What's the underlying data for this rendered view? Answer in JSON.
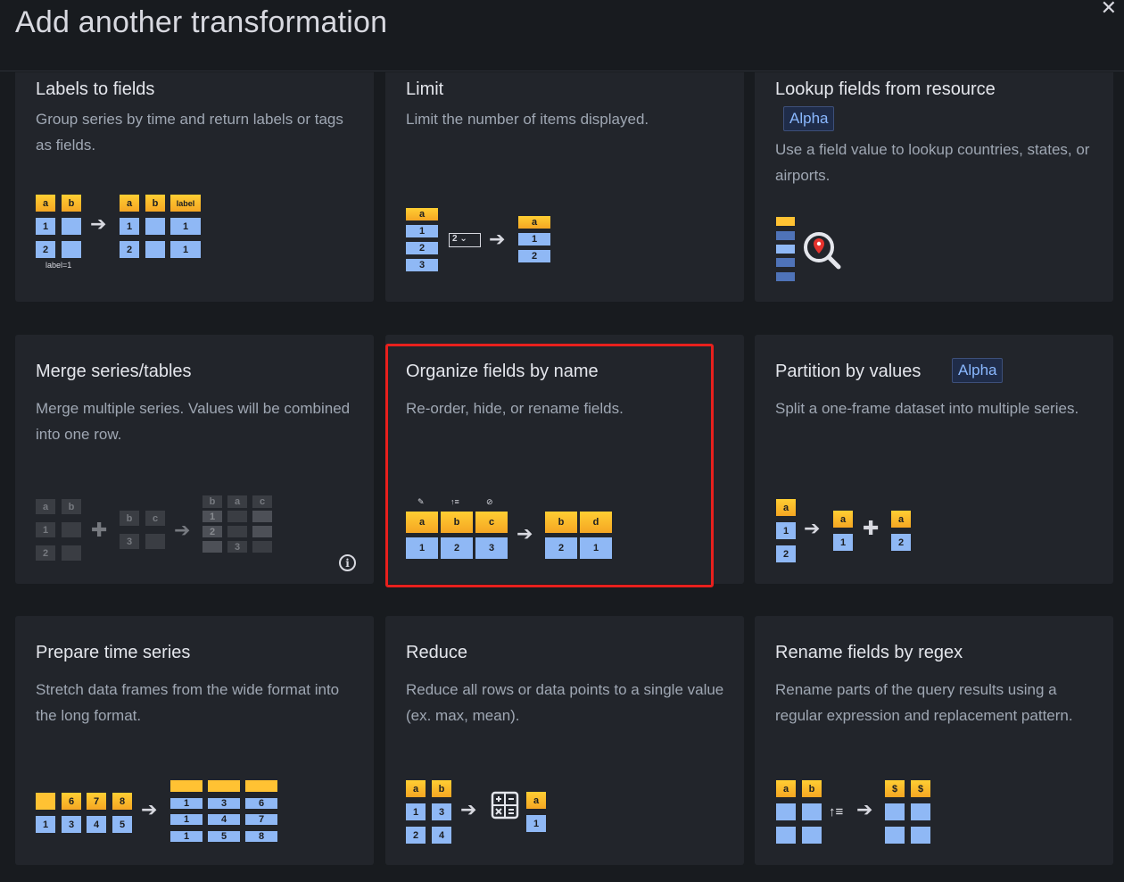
{
  "header": {
    "title": "Add another transformation",
    "close_icon": "close-icon"
  },
  "cards": [
    {
      "title": "Labels to fields",
      "description": "Group series by time and return labels or tags as fields."
    },
    {
      "title": "Limit",
      "description": "Limit the number of items displayed."
    },
    {
      "title": "Lookup fields from resource",
      "badge": "Alpha",
      "description": "Use a field value to lookup countries, states, or airports."
    },
    {
      "title": "Merge series/tables",
      "description": "Merge multiple series. Values will be combined into one row."
    },
    {
      "title": "Organize fields by name",
      "description": "Re-order, hide, or rename fields."
    },
    {
      "title": "Partition by values",
      "badge": "Alpha",
      "description": "Split a one-frame dataset into multiple series."
    },
    {
      "title": "Prepare time series",
      "description": "Stretch data frames from the wide format into the long format."
    },
    {
      "title": "Reduce",
      "description": "Reduce all rows or data points to a single value (ex. max, mean)."
    },
    {
      "title": "Rename fields by regex",
      "description": "Rename parts of the query results using a regular expression and replacement pattern."
    }
  ],
  "illustrations": {
    "labels_to_fields": {
      "h1": "a",
      "h2": "b",
      "label": "label",
      "r1": "1",
      "r2": "2",
      "out": "1",
      "caption": "label=1"
    },
    "limit": {
      "h": "a",
      "v1": "1",
      "v2": "2",
      "v3": "3",
      "select": "2",
      "o1": "1",
      "o2": "2"
    },
    "merge": {
      "a": "a",
      "b": "b",
      "c": "c",
      "one": "1",
      "two": "2",
      "three": "3"
    },
    "organize": {
      "h": [
        "a",
        "b",
        "c"
      ],
      "v": [
        "1",
        "2",
        "3"
      ],
      "oh": [
        "b",
        "d"
      ],
      "ov": [
        "2",
        "1"
      ]
    },
    "partition": {
      "a": "a",
      "one": "1",
      "two": "2"
    },
    "prepare": {
      "top": [
        "6",
        "7",
        "8"
      ],
      "bot": [
        "1",
        "3",
        "4",
        "5"
      ],
      "c1": [
        "1",
        "1",
        "1"
      ],
      "c2": [
        "3",
        "4",
        "5"
      ],
      "c3": [
        "6",
        "7",
        "8"
      ]
    },
    "reduce": {
      "a": "a",
      "b": "b",
      "v": [
        "1",
        "3",
        "2",
        "4"
      ],
      "out": "1"
    },
    "rename": {
      "a": "a",
      "b": "b",
      "dollar": "$"
    }
  },
  "colors": {
    "accent_yellow": "#ffc233",
    "accent_blue": "#8fb8f5",
    "highlight_red": "#e8201d",
    "badge_text": "#8ab8ff"
  }
}
